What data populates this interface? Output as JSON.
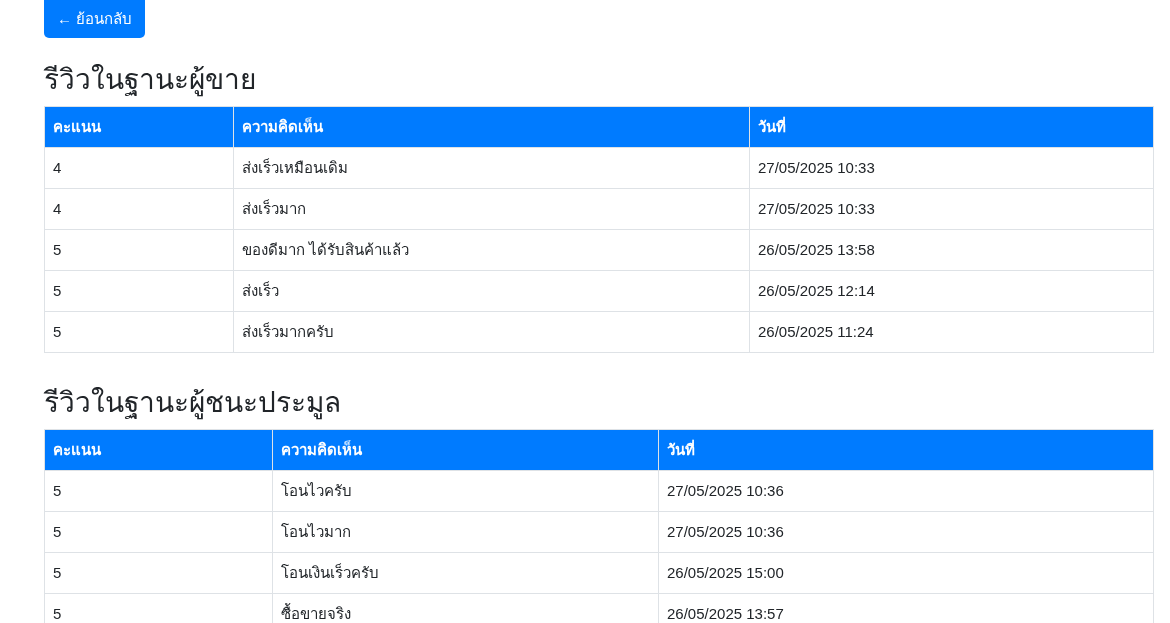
{
  "back_button": {
    "label": "← ย้อนกลับ"
  },
  "sections": [
    {
      "title": "รีวิวในฐานะผู้ขาย",
      "columns": [
        "คะแนน",
        "ความคิดเห็น",
        "วันที่"
      ],
      "rows": [
        [
          "4",
          "ส่งเร็วเหมือนเดิม",
          "27/05/2025 10:33"
        ],
        [
          "4",
          "ส่งเร็วมาก",
          "27/05/2025 10:33"
        ],
        [
          "5",
          "ของดีมาก ได้รับสินค้าแล้ว",
          "26/05/2025 13:58"
        ],
        [
          "5",
          "ส่งเร็ว",
          "26/05/2025 12:14"
        ],
        [
          "5",
          "ส่งเร็วมากครับ",
          "26/05/2025 11:24"
        ]
      ]
    },
    {
      "title": "รีวิวในฐานะผู้ชนะประมูล",
      "columns": [
        "คะแนน",
        "ความคิดเห็น",
        "วันที่"
      ],
      "rows": [
        [
          "5",
          "โอนไวครับ",
          "27/05/2025 10:36"
        ],
        [
          "5",
          "โอนไวมาก",
          "27/05/2025 10:36"
        ],
        [
          "5",
          "โอนเงินเร็วครับ",
          "26/05/2025 15:00"
        ],
        [
          "5",
          "ซื้อขายจริง",
          "26/05/2025 13:57"
        ]
      ]
    }
  ]
}
